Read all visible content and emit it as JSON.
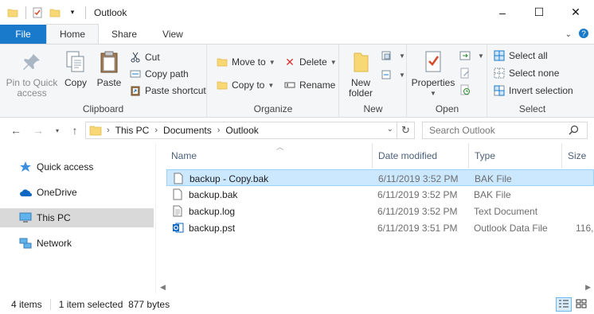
{
  "window": {
    "title": "Outlook",
    "controls": {
      "minimize": "–",
      "maximize": "☐",
      "close": "✕"
    }
  },
  "ribbon_tabs": [
    "File",
    "Home",
    "Share",
    "View"
  ],
  "ribbon": {
    "clipboard": {
      "label": "Clipboard",
      "pin_label": "Pin to Quick access",
      "copy_label": "Copy",
      "paste_label": "Paste",
      "cut_label": "Cut",
      "copy_path_label": "Copy path",
      "paste_shortcut_label": "Paste shortcut"
    },
    "organize": {
      "label": "Organize",
      "move_to_label": "Move to",
      "copy_to_label": "Copy to",
      "delete_label": "Delete",
      "rename_label": "Rename"
    },
    "new": {
      "label": "New",
      "new_folder_label": "New folder"
    },
    "open": {
      "label": "Open",
      "properties_label": "Properties"
    },
    "select": {
      "label": "Select",
      "select_all_label": "Select all",
      "select_none_label": "Select none",
      "invert_label": "Invert selection"
    }
  },
  "address": {
    "crumbs": [
      "This PC",
      "Documents",
      "Outlook"
    ],
    "search_placeholder": "Search Outlook"
  },
  "nav_pane": [
    {
      "label": "Quick access",
      "icon": "star-icon"
    },
    {
      "label": "OneDrive",
      "icon": "cloud-icon"
    },
    {
      "label": "This PC",
      "icon": "computer-icon"
    },
    {
      "label": "Network",
      "icon": "network-icon"
    }
  ],
  "columns": {
    "name": "Name",
    "date": "Date modified",
    "type": "Type",
    "size": "Size"
  },
  "files": [
    {
      "name": "backup - Copy.bak",
      "date": "6/11/2019 3:52 PM",
      "type": "BAK File",
      "size": ""
    },
    {
      "name": "backup.bak",
      "date": "6/11/2019 3:52 PM",
      "type": "BAK File",
      "size": ""
    },
    {
      "name": "backup.log",
      "date": "6/11/2019 3:52 PM",
      "type": "Text Document",
      "size": ""
    },
    {
      "name": "backup.pst",
      "date": "6/11/2019 3:51 PM",
      "type": "Outlook Data File",
      "size": "116,…"
    }
  ],
  "status": {
    "item_count": "4 items",
    "selection": "1 item selected  877 bytes"
  },
  "colors": {
    "accent": "#1979ca",
    "selected_row": "#cce8ff",
    "folder": "#f8d775"
  }
}
